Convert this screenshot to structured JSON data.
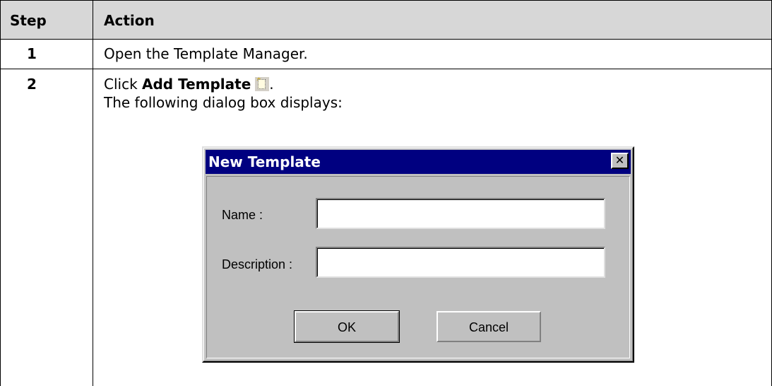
{
  "table": {
    "headers": {
      "step": "Step",
      "action": "Action"
    },
    "rows": [
      {
        "step": "1",
        "action": "Open the Template Manager."
      },
      {
        "step": "2",
        "action_prefix": "Click ",
        "action_bold": "Add Template",
        "action_suffix": ".",
        "action_line2": "The following dialog box displays:",
        "icon": "add-template-icon"
      }
    ]
  },
  "dialog": {
    "title": "New Template",
    "close_glyph": "✕",
    "name_label": "Name :",
    "name_value": "",
    "description_label": "Description :",
    "description_value": "",
    "ok_label": "OK",
    "cancel_label": "Cancel"
  },
  "colors": {
    "header_bg": "#d7d7d7",
    "dialog_bg": "#c0c0c0",
    "titlebar": "#000080"
  }
}
